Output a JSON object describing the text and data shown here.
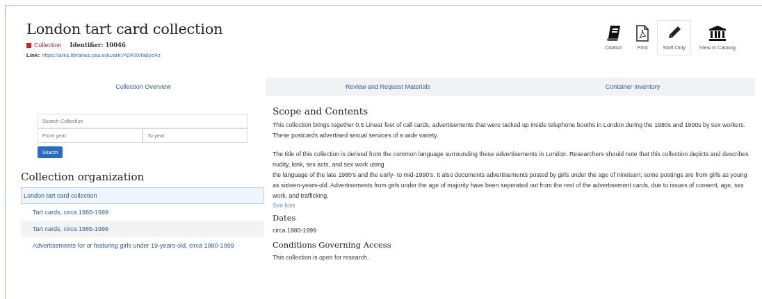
{
  "header": {
    "title": "London tart card collection",
    "type_label": "Collection",
    "identifier_label": "Identifier:",
    "identifier": "10046",
    "link_label": "Link:",
    "link": "https://arks.libraries.psu.edu/ark:/42409/fa8pd4z"
  },
  "actions": [
    {
      "kind": "book",
      "label": "Citation",
      "outlined": false
    },
    {
      "kind": "pdf",
      "label": "Print",
      "outlined": false
    },
    {
      "kind": "pencil",
      "label": "Staff Only",
      "outlined": true
    },
    {
      "kind": "bank",
      "label": "View in Catalog",
      "outlined": false
    }
  ],
  "tabs": [
    {
      "label": "Collection Overview",
      "selected": true
    },
    {
      "label": "Review and Request Materials",
      "selected": false
    },
    {
      "label": "Container Inventory",
      "selected": false
    }
  ],
  "search": {
    "placeholder": "Search Collection",
    "from_placeholder": "From year",
    "to_placeholder": "To year",
    "button": "Search"
  },
  "organization": {
    "heading": "Collection organization",
    "tree": [
      {
        "label": "London tart card collection",
        "selected": true,
        "children": [
          {
            "label": "Tart cards, circa 1980-1999",
            "selected": false
          },
          {
            "label": "Tart cards, circa 1985-1999",
            "selected": false
          },
          {
            "label": "Advertisements for or featuring girls under 19-years-old, circa 1980-1999",
            "selected": false
          }
        ]
      }
    ]
  },
  "sections": [
    {
      "heading": "Scope and Contents",
      "paragraphs": [
        [
          "This collection brings together 0.5 Linear feet of call cards, advertisements that were tacked up inside telephone booths in London during the 1980s and 1990s by sex workers. These postcards advertised sexual services of a wide variety."
        ],
        [
          "The title of this collection is derived from the common language surrounding these advertisements in London. Researchers should note that this collection depicts and describes nudity, kink, sex acts, and sex work using",
          "the language of the late 1980's and the early- to mid-1990's. It also documents advertisements posted by girls under the age of nineteen; some postings are from girls as young as sixteen-years-old. Advertisements from girls under the age of majority have been seperated out from the rest of the advertisement cards, due to issues of consent, age, sex work, and trafficking."
        ]
      ],
      "more_link": "See less"
    },
    {
      "heading": "Dates",
      "paragraphs": [
        [
          "circa 1980-1999"
        ]
      ]
    },
    {
      "heading": "Conditions Governing Access",
      "paragraphs": [
        [
          "This collection is open for research."
        ]
      ]
    }
  ]
}
